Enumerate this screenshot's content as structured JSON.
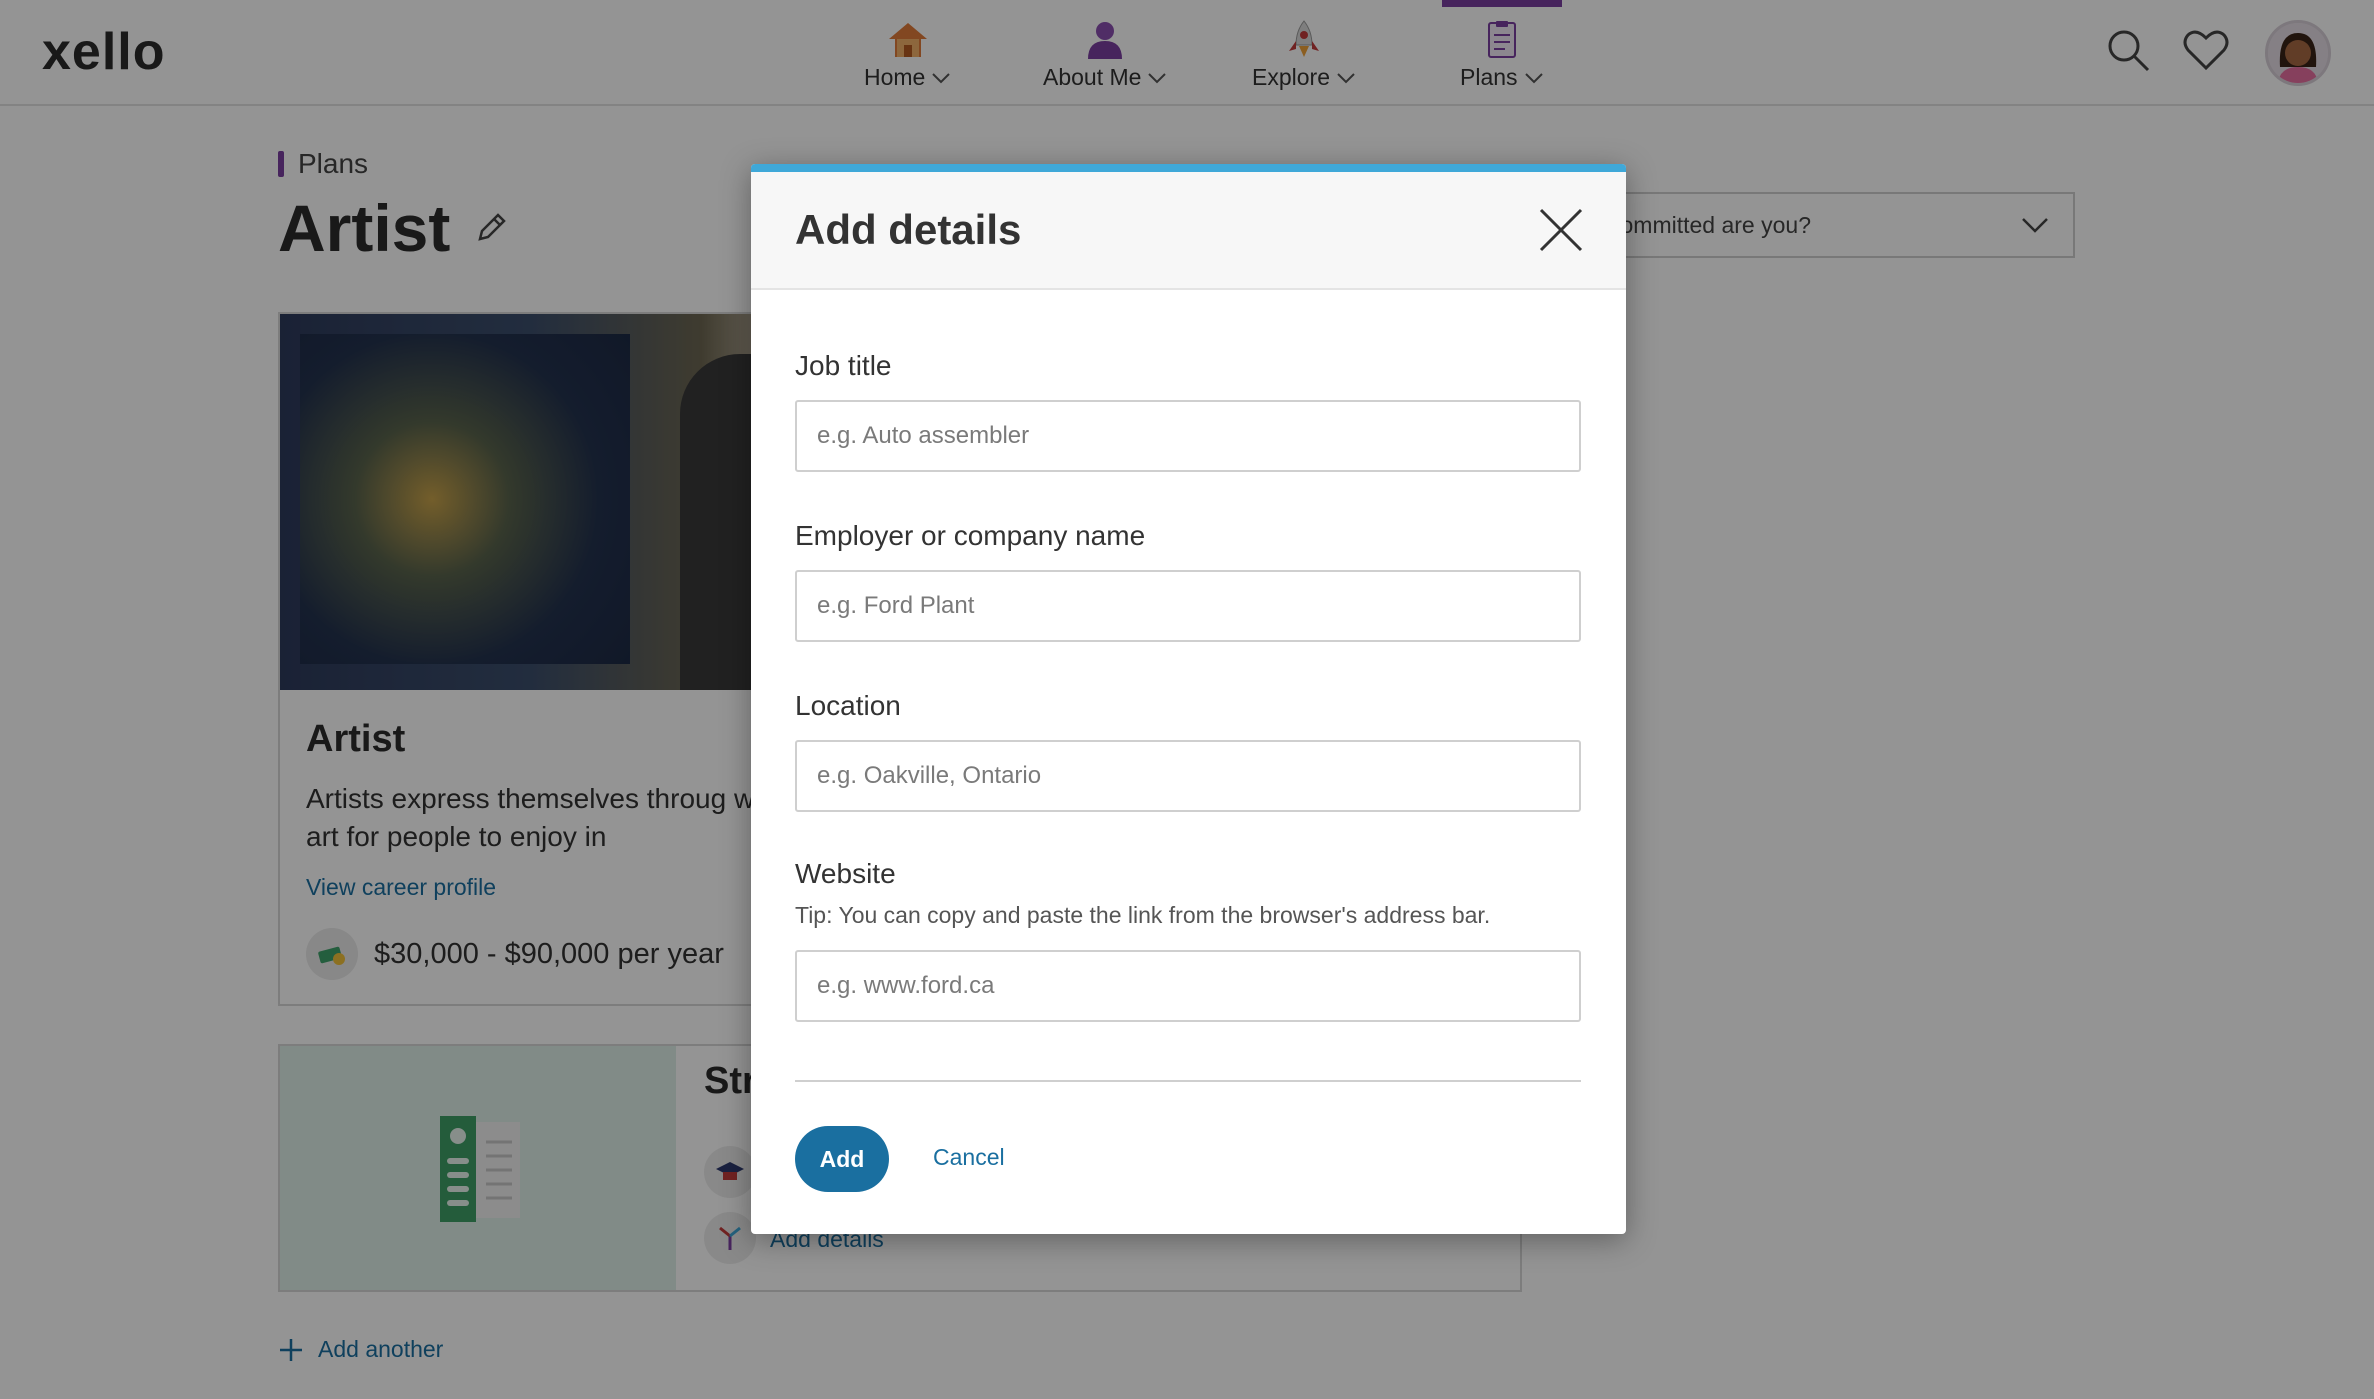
{
  "header": {
    "logo": "xello",
    "nav": [
      {
        "label": "Home",
        "icon": "house-icon"
      },
      {
        "label": "About Me",
        "icon": "person-icon"
      },
      {
        "label": "Explore",
        "icon": "rocket-icon"
      },
      {
        "label": "Plans",
        "icon": "clipboard-icon",
        "active": true
      }
    ],
    "icons": [
      "search-icon",
      "heart-icon",
      "avatar"
    ]
  },
  "page": {
    "breadcrumb": "Plans",
    "title": "Artist",
    "commit_select": "w committed are you?",
    "career": {
      "name": "Artist",
      "description": "Artists express themselves throug works of art for people to enjoy in",
      "link": "View career profile",
      "salary": "$30,000 - $90,000 per year"
    },
    "plan": {
      "title": "Str",
      "link": "Add details"
    },
    "add_another": "Add another"
  },
  "modal": {
    "title": "Add details",
    "fields": {
      "job_title": {
        "label": "Job title",
        "placeholder": "e.g. Auto assembler"
      },
      "employer": {
        "label": "Employer or company name",
        "placeholder": "e.g. Ford Plant"
      },
      "location": {
        "label": "Location",
        "placeholder": "e.g. Oakville, Ontario"
      },
      "website": {
        "label": "Website",
        "tip": "Tip: You can copy and paste the link from the browser's address bar.",
        "placeholder": "e.g. www.ford.ca"
      }
    },
    "add_label": "Add",
    "cancel_label": "Cancel"
  },
  "colors": {
    "brand_purple": "#7a3ea0",
    "link_blue": "#1a6fa0",
    "modal_accent": "#3fa8d8"
  }
}
